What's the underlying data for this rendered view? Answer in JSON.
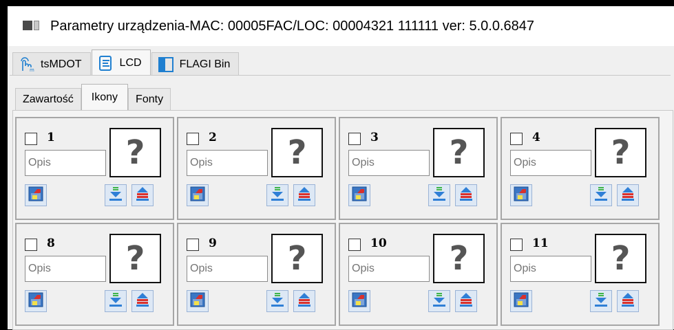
{
  "window": {
    "title": "Parametry urządzenia-MAC: 00005FAC/LOC: 00004321 111111 ver: 5.0.0.6847"
  },
  "main_tabs": [
    {
      "label": "tsMDOT",
      "icon": "touch-pointer-icon"
    },
    {
      "label": "LCD",
      "icon": "list-icon",
      "active": true
    },
    {
      "label": "FLAGI Bin",
      "icon": "panel-icon"
    }
  ],
  "sub_tabs": [
    {
      "label": "Zawartość"
    },
    {
      "label": "Ikony",
      "active": true
    },
    {
      "label": "Fonty"
    }
  ],
  "icon_cells": [
    {
      "number": "1",
      "description_placeholder": "Opis",
      "preview": "?"
    },
    {
      "number": "2",
      "description_placeholder": "Opis",
      "preview": "?"
    },
    {
      "number": "3",
      "description_placeholder": "Opis",
      "preview": "?"
    },
    {
      "number": "4",
      "description_placeholder": "Opis",
      "preview": "?"
    },
    {
      "number": "8",
      "description_placeholder": "Opis",
      "preview": "?"
    },
    {
      "number": "9",
      "description_placeholder": "Opis",
      "preview": "?"
    },
    {
      "number": "10",
      "description_placeholder": "Opis",
      "preview": "?"
    },
    {
      "number": "11",
      "description_placeholder": "Opis",
      "preview": "?"
    }
  ],
  "colors": {
    "accent_blue": "#2f7fd6",
    "accent_red": "#d9302c",
    "accent_green": "#3fb54a"
  }
}
